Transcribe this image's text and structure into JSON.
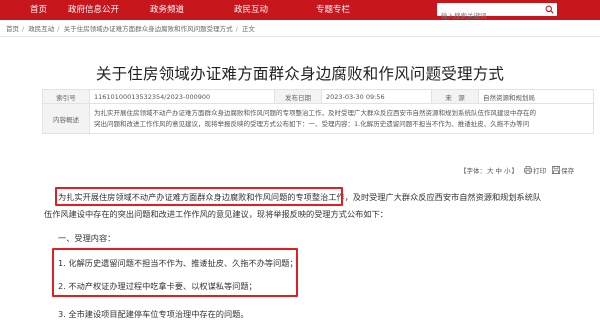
{
  "nav": {
    "items": [
      "首页",
      "政府信息公开",
      "政务频道",
      "政民互动",
      "专题专栏"
    ],
    "search_placeholder": "输入搜索关键词"
  },
  "breadcrumb": [
    "首页",
    "政民互动",
    "关于住房领域办证难方面群众身边腐败和作风问题受理方式",
    "正文"
  ],
  "article": {
    "title": "关于住房领域办证难方面群众身边腐败和作风问题受理方式",
    "meta": {
      "index_label": "索引号",
      "index_value": "11610100013532354/2023-000900",
      "date_label": "发布日期",
      "date_value": "2023-03-30 09:56",
      "source_label": "来　源",
      "source_value": "自然资源和规划局",
      "summary_label": "内容概述",
      "summary_line1": "为扎实开展住房领域不动产办证难方面群众身边腐败和作风问题的专项整治工作，及时受理广大群众反应西安市自然资源和规划系统队伍作风建设中存在的",
      "summary_line2": "突出问题和改进工作作风的意见建议，现将举报反映的受理方式公布如下：一、受理内容：1.化解历史遗留问题不担当不作为、推诿扯皮、久拖不办等问"
    },
    "tools": {
      "font_label": "【字体：",
      "size_big": "大",
      "size_mid": "中",
      "size_small": "小",
      "font_end": "】",
      "print": "打印",
      "save": "保存"
    },
    "para1_highlight": "为扎实开展住房领域不动产办证难方面群众身边腐败和作风问题的专项整治工作，",
    "para1_rest": "及时受理广大群众反应西安市自然资源和规划系统队",
    "para1_line2": "伍作风建设中存在的突出问题和改进工作作风的意见建议，现将举报反映的受理方式公布如下：",
    "section1": "一、受理内容：",
    "item1": "1. 化解历史遗留问题不担当不作为、推诿扯皮、久拖不办等问题；",
    "item2": "2. 不动产权证办理过程中吃拿卡要、以权谋私等问题；",
    "item3": "3. 全市建设项目配建停车位专项治理中存在的问题。"
  },
  "colors": {
    "brand": "#c8161d",
    "highlight_box": "#e02020"
  }
}
